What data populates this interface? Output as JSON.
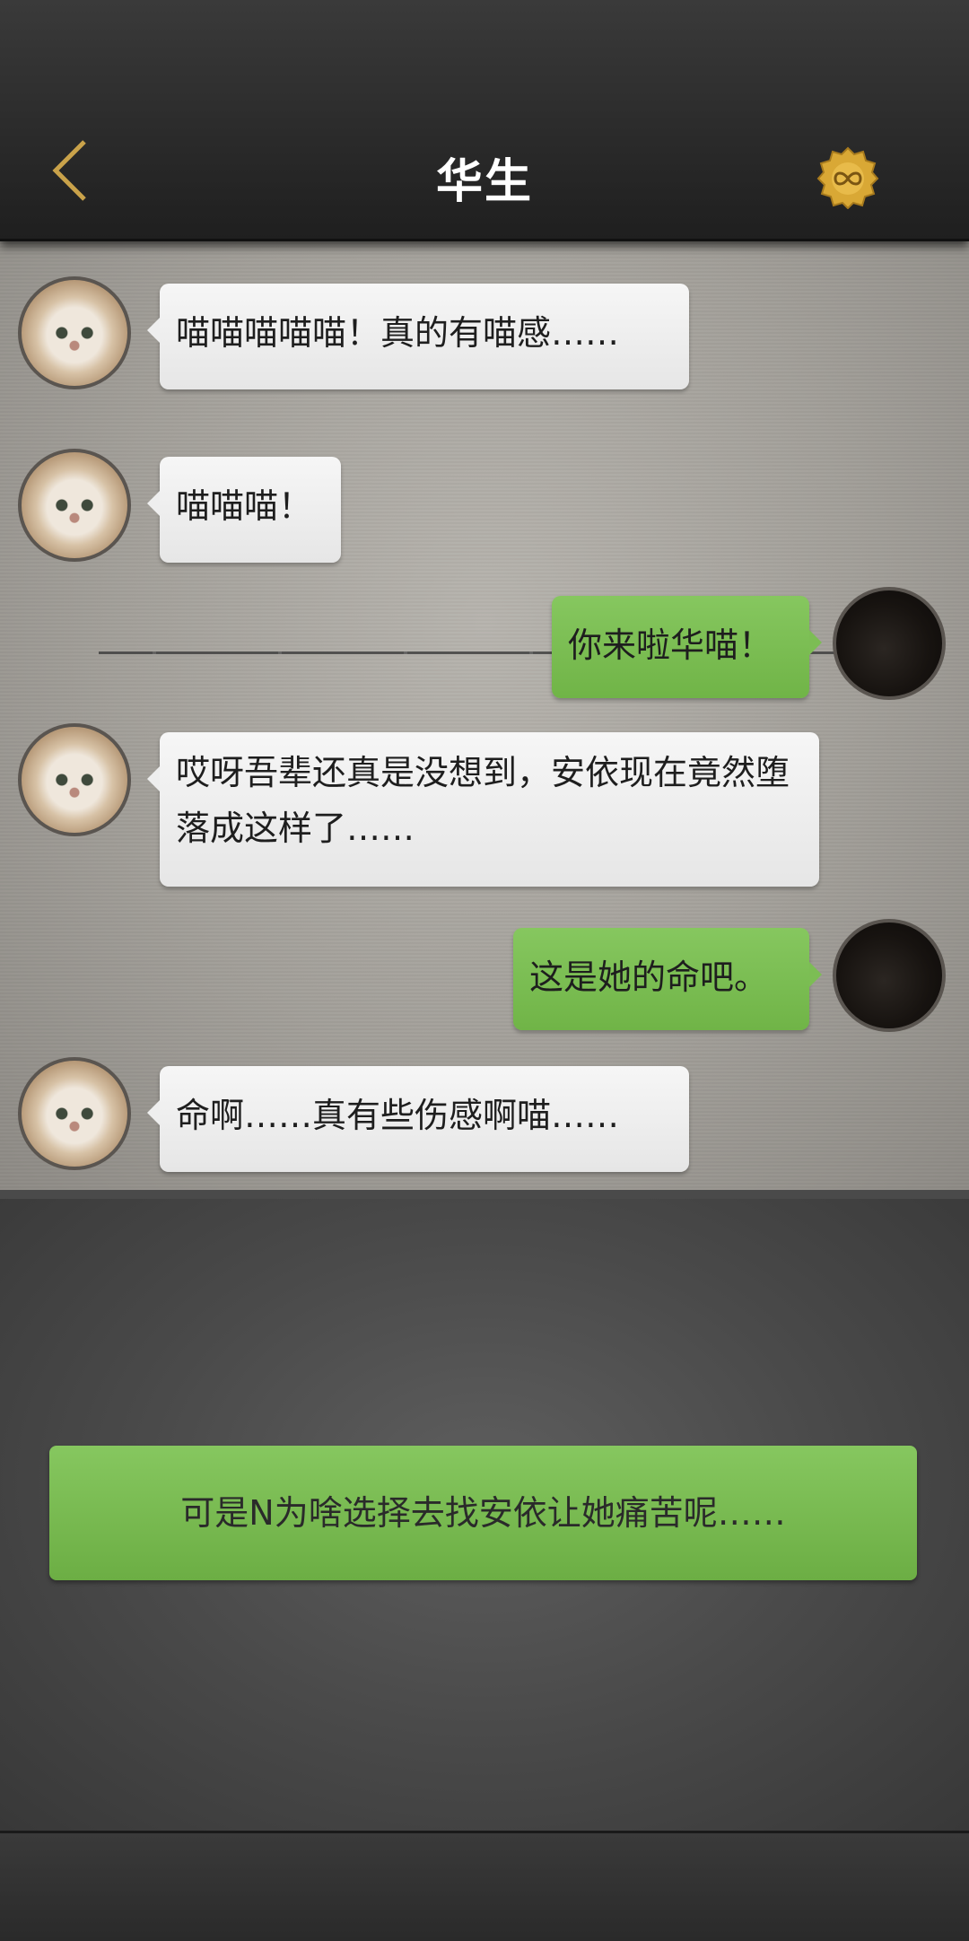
{
  "header": {
    "title": "华生",
    "back_icon": "chevron-left-icon",
    "badge_icon": "infinity-medal-icon",
    "accent": "#c9a24a"
  },
  "messages": [
    {
      "side": "left",
      "text": "喵喵喵喵喵！真的有喵感……"
    },
    {
      "side": "left",
      "text": "喵喵喵！"
    },
    {
      "side": "right",
      "text": "你来啦华喵！"
    },
    {
      "side": "left",
      "text": "哎呀吾辈还真是没想到，安依现在竟然堕落成这样了……"
    },
    {
      "side": "right",
      "text": "这是她的命吧。"
    },
    {
      "side": "left",
      "text": "命啊……真有些伤感啊喵……"
    }
  ],
  "choice": {
    "label": "可是N为啥选择去找安依让她痛苦呢……"
  },
  "colors": {
    "bubble_green": "#7cbd54",
    "bubble_white": "#eeeeee"
  }
}
